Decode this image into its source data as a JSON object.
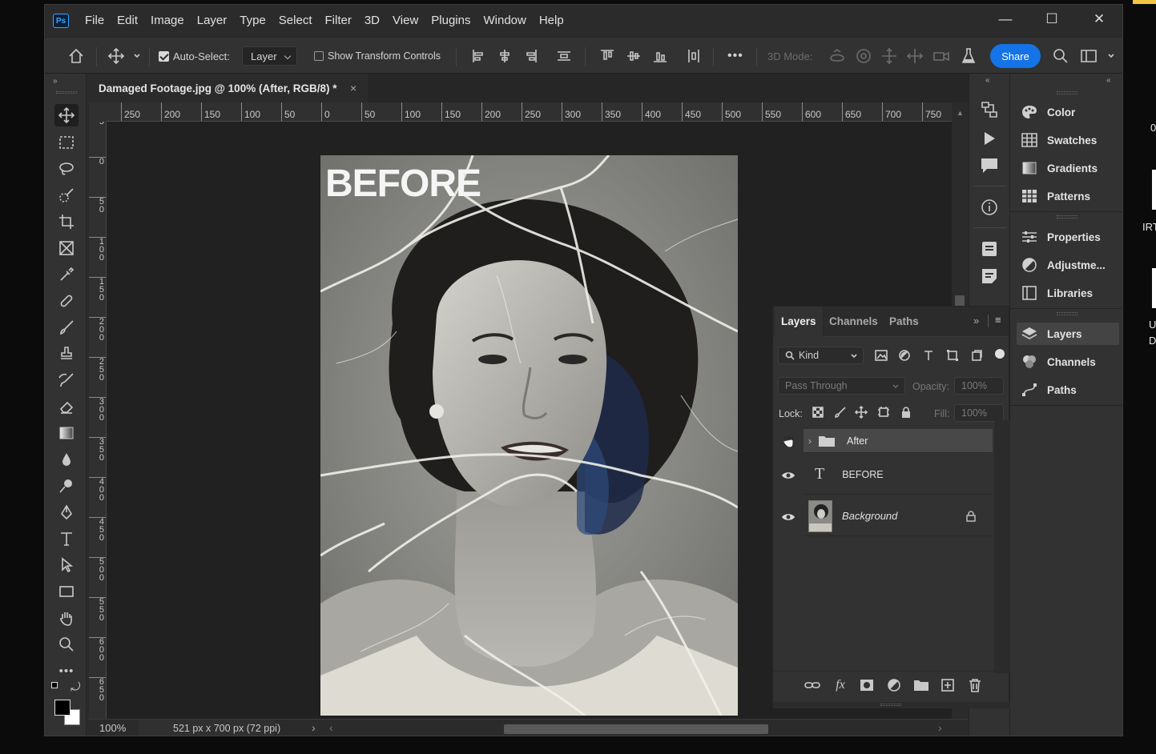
{
  "menu": {
    "items": [
      "File",
      "Edit",
      "Image",
      "Layer",
      "Type",
      "Select",
      "Filter",
      "3D",
      "View",
      "Plugins",
      "Window",
      "Help"
    ]
  },
  "window_controls": {
    "minimize": "—",
    "maximize": "☐",
    "close": "✕"
  },
  "options_bar": {
    "auto_select_label": "Auto-Select:",
    "auto_select_checked": true,
    "auto_select_target": "Layer",
    "show_transform_label": "Show Transform Controls",
    "show_transform_checked": false,
    "more_label": "•••",
    "mode_3d_label": "3D Mode:",
    "share_label": "Share"
  },
  "document": {
    "tab_title": "Damaged Footage.jpg @ 100% (After, RGB/8) *",
    "zoom": "100%",
    "dimensions": "521 px x 700 px (72 ppi)",
    "image_text": "BEFORE"
  },
  "rulers": {
    "horizontal": [
      "250",
      "200",
      "150",
      "100",
      "50",
      "0",
      "50",
      "100",
      "150",
      "200",
      "250",
      "300",
      "350",
      "400",
      "450",
      "500",
      "550",
      "600",
      "650",
      "700",
      "750"
    ],
    "vertical": [
      "5",
      "0",
      "5 0",
      "1 0 0",
      "1 5 0",
      "2 0 0",
      "2 5 0",
      "3 0 0",
      "3 5 0",
      "4 0 0",
      "4 5 0",
      "5 0 0",
      "5 5 0",
      "6 0 0",
      "6 5 0"
    ]
  },
  "right_panels": {
    "group1": [
      "Color",
      "Swatches",
      "Gradients",
      "Patterns"
    ],
    "group2": [
      "Properties",
      "Adjustme...",
      "Libraries"
    ],
    "group3": [
      "Layers",
      "Channels",
      "Paths"
    ]
  },
  "layers_panel": {
    "tabs": [
      "Layers",
      "Channels",
      "Paths"
    ],
    "filter_kind": "Kind",
    "blend_mode": "Pass Through",
    "opacity_label": "Opacity:",
    "opacity_value": "100%",
    "lock_label": "Lock:",
    "fill_label": "Fill:",
    "fill_value": "100%",
    "layers": [
      {
        "name": "After",
        "type": "group",
        "visible": false
      },
      {
        "name": "BEFORE",
        "type": "text",
        "visible": true
      },
      {
        "name": "Background",
        "type": "image",
        "visible": true,
        "locked": true
      }
    ]
  },
  "outside": {
    "t1": "0",
    "t2": "IRT",
    "t3": "U",
    "t4": "D"
  },
  "colors": {
    "accent": "#1473e6",
    "panel": "#323232",
    "canvas": "#212121"
  }
}
